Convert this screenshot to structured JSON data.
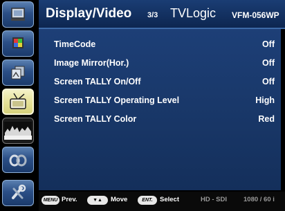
{
  "header": {
    "title": "Display/Video",
    "page": "3/3",
    "brand": "TVLogic",
    "model": "VFM-056WP"
  },
  "sidebar": {
    "items": [
      {
        "icon": "monitor-icon",
        "active": false
      },
      {
        "icon": "color-palette-icon",
        "active": false
      },
      {
        "icon": "image-layers-icon",
        "active": false
      },
      {
        "icon": "tv-antenna-icon",
        "active": true
      },
      {
        "icon": "waveform-icon",
        "active": false
      },
      {
        "icon": "link-icon",
        "active": false
      },
      {
        "icon": "tools-icon",
        "active": false
      }
    ]
  },
  "menu": {
    "rows": [
      {
        "label": "TimeCode",
        "value": "Off"
      },
      {
        "label": "Image Mirror(Hor.)",
        "value": "Off"
      },
      {
        "label": "Screen TALLY On/Off",
        "value": "Off"
      },
      {
        "label": "Screen TALLY Operating Level",
        "value": "High"
      },
      {
        "label": "Screen TALLY Color",
        "value": "Red"
      }
    ]
  },
  "footer": {
    "menu_key": "MENU",
    "prev": "Prev.",
    "updown_key": "▼▲",
    "move": "Move",
    "enter_key": "ENT.",
    "select": "Select",
    "signal": "HD - SDI",
    "format": "1080 / 60 i"
  }
}
